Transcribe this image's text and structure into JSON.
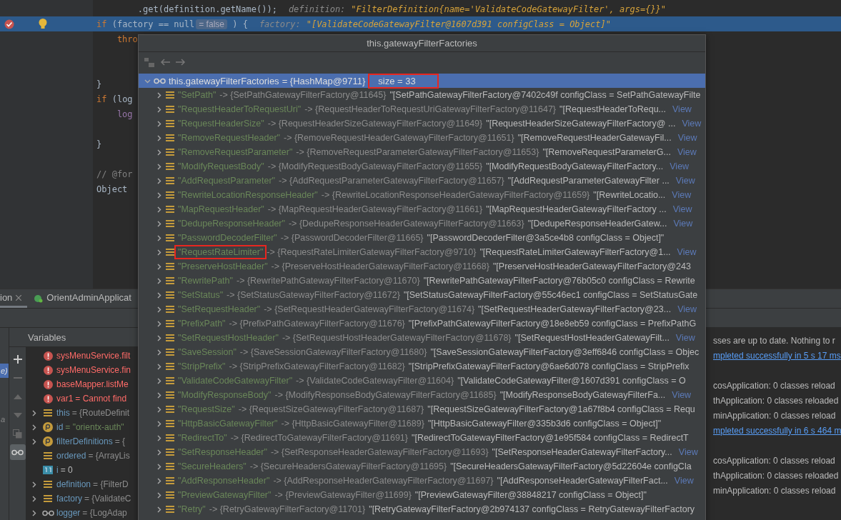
{
  "editor": {
    "lines": [
      {
        "breakpoint": false,
        "current": false,
        "segments": [
          {
            "kind": "code",
            "text": "        .get(definition.getName());"
          },
          {
            "kind": "hint_name",
            "text": "definition:"
          },
          {
            "kind": "hint_value",
            "text": "\"FilterDefinition{name='ValidateCodeGatewayFilter', args={}}\""
          }
        ]
      },
      {
        "breakpoint": true,
        "current": true,
        "segments": [
          {
            "kind": "keyword",
            "text": "if"
          },
          {
            "kind": "code",
            "text": " (factory == null"
          },
          {
            "kind": "badge",
            "text": "= false"
          },
          {
            "kind": "code",
            "text": " ) {"
          },
          {
            "kind": "hint_name",
            "text": "factory:"
          },
          {
            "kind": "hint_value",
            "text": "\"[ValidateCodeGatewayFilter@1607d391 configClass = Object]\""
          }
        ]
      },
      {
        "breakpoint": false,
        "current": false,
        "segments": [
          {
            "kind": "keyword",
            "text": "    thro"
          }
        ]
      },
      {
        "breakpoint": false,
        "current": false
      },
      {
        "breakpoint": false,
        "current": false
      },
      {
        "breakpoint": false,
        "current": false,
        "segments": [
          {
            "kind": "code",
            "text": "}"
          }
        ]
      },
      {
        "breakpoint": false,
        "current": false,
        "segments": [
          {
            "kind": "keyword",
            "text": "if"
          },
          {
            "kind": "code",
            "text": " (log"
          }
        ]
      },
      {
        "breakpoint": false,
        "current": false,
        "segments": [
          {
            "kind": "field",
            "text": "    log"
          }
        ]
      },
      {
        "breakpoint": false,
        "current": false
      },
      {
        "breakpoint": false,
        "current": false,
        "segments": [
          {
            "kind": "code",
            "text": "}"
          }
        ]
      },
      {
        "breakpoint": false,
        "current": false
      },
      {
        "breakpoint": false,
        "current": false,
        "segments": [
          {
            "kind": "comment",
            "text": "// @for"
          }
        ]
      },
      {
        "breakpoint": false,
        "current": false,
        "segments": [
          {
            "kind": "code",
            "text": "Object"
          }
        ]
      }
    ]
  },
  "debug": {
    "tabs": [
      {
        "label": "ion",
        "selected": true,
        "closable": true
      },
      {
        "label": "OrientAdminApplicat",
        "selected": false,
        "closable": false
      }
    ],
    "frames": [
      {
        "text": "e)",
        "selected": true
      },
      {
        "text": "a",
        "selected": false
      }
    ],
    "variables_title": "Variables",
    "tools": [
      {
        "kind": "add",
        "disabled": false,
        "selected": false
      },
      {
        "kind": "remove",
        "disabled": true,
        "selected": false
      },
      {
        "kind": "up",
        "disabled": true,
        "selected": false
      },
      {
        "kind": "down",
        "disabled": true,
        "selected": false
      },
      {
        "kind": "copy",
        "disabled": true,
        "selected": false
      },
      {
        "kind": "watches",
        "disabled": false,
        "selected": true
      }
    ],
    "variables": [
      {
        "kind": "error",
        "expandable": false,
        "name": "sysMenuService.filt"
      },
      {
        "kind": "error",
        "expandable": false,
        "name": "sysMenuService.fin"
      },
      {
        "kind": "error",
        "expandable": false,
        "name": "baseMapper.listMe"
      },
      {
        "kind": "error",
        "expandable": false,
        "name": "var1",
        "value": "= Cannot find"
      },
      {
        "kind": "object",
        "expandable": true,
        "name": "this",
        "value": "= {RouteDefinit"
      },
      {
        "kind": "field",
        "expandable": true,
        "name": "id",
        "value": "= \"orientx-auth\""
      },
      {
        "kind": "field",
        "expandable": true,
        "name": "filterDefinitions",
        "value": "= {"
      },
      {
        "kind": "object",
        "expandable": false,
        "name": "ordered",
        "value": "= {ArrayLis"
      },
      {
        "kind": "primitive",
        "expandable": false,
        "name": "i",
        "value": "= 0"
      },
      {
        "kind": "object",
        "expandable": true,
        "name": "definition",
        "value": "= {FilterD"
      },
      {
        "kind": "object",
        "expandable": true,
        "name": "factory",
        "value": "= {ValidateC"
      },
      {
        "kind": "watch",
        "expandable": true,
        "name": "logger",
        "value": "= {LogAdap"
      }
    ],
    "console": [
      {
        "kind": "text",
        "text": "sses are up to date. Nothing to r"
      },
      {
        "kind": "link",
        "text": "mpleted successfully in 5 s 17 ms"
      },
      {
        "kind": "text",
        "text": "cosApplication: 0 classes reload"
      },
      {
        "kind": "text",
        "text": "thApplication: 0 classes reloaded"
      },
      {
        "kind": "text",
        "text": "minApplication: 0 classes reload"
      },
      {
        "kind": "link",
        "text": "mpleted successfully in 6 s 464 m"
      },
      {
        "kind": "text",
        "text": "cosApplication: 0 classes reload"
      },
      {
        "kind": "text",
        "text": "thApplication: 0 classes reloaded"
      },
      {
        "kind": "text",
        "text": "minApplication: 0 classes reload"
      }
    ]
  },
  "popup": {
    "title": "this.gatewayFilterFactories",
    "root": {
      "name": "this.gatewayFilterFactories",
      "value": "= {HashMap@9711}",
      "size": "size = 33",
      "selected": true,
      "annotated": true
    },
    "entries": [
      {
        "key": "\"SetPath\"",
        "type": "-> {SetPathGatewayFilterFactory@11645}",
        "value": "\"[SetPathGatewayFilterFactory@7402c49f configClass = SetPathGatewayFilte",
        "annotated": false
      },
      {
        "key": "\"RequestHeaderToRequestUri\"",
        "type": "-> {RequestHeaderToRequestUriGatewayFilterFactory@11647}",
        "value": "\"[RequestHeaderToRequ...",
        "link": "View",
        "annotated": false
      },
      {
        "key": "\"RequestHeaderSize\"",
        "type": "-> {RequestHeaderSizeGatewayFilterFactory@11649}",
        "value": "\"[RequestHeaderSizeGatewayFilterFactory@ ...",
        "link": "View",
        "annotated": false
      },
      {
        "key": "\"RemoveRequestHeader\"",
        "type": "-> {RemoveRequestHeaderGatewayFilterFactory@11651}",
        "value": "\"[RemoveRequestHeaderGatewayFil...",
        "link": "View",
        "annotated": false
      },
      {
        "key": "\"RemoveRequestParameter\"",
        "type": "-> {RemoveRequestParameterGatewayFilterFactory@11653}",
        "value": "\"[RemoveRequestParameterG...",
        "link": "View",
        "annotated": false
      },
      {
        "key": "\"ModifyRequestBody\"",
        "type": "-> {ModifyRequestBodyGatewayFilterFactory@11655}",
        "value": "\"[ModifyRequestBodyGatewayFilterFactory...",
        "link": "View",
        "annotated": false
      },
      {
        "key": "\"AddRequestParameter\"",
        "type": "-> {AddRequestParameterGatewayFilterFactory@11657}",
        "value": "\"[AddRequestParameterGatewayFilter ...",
        "link": "View",
        "annotated": false
      },
      {
        "key": "\"RewriteLocationResponseHeader\"",
        "type": "-> {RewriteLocationResponseHeaderGatewayFilterFactory@11659}",
        "value": "\"[RewriteLocatio...",
        "link": "View",
        "annotated": false
      },
      {
        "key": "\"MapRequestHeader\"",
        "type": "-> {MapRequestHeaderGatewayFilterFactory@11661}",
        "value": "\"[MapRequestHeaderGatewayFilterFactory ...",
        "link": "View",
        "annotated": false
      },
      {
        "key": "\"DedupeResponseHeader\"",
        "type": "-> {DedupeResponseHeaderGatewayFilterFactory@11663}",
        "value": "\"[DedupeResponseHeaderGatew...",
        "link": "View",
        "annotated": false
      },
      {
        "key": "\"PasswordDecoderFilter\"",
        "type": "-> {PasswordDecoderFilter@11665}",
        "value": "\"[PasswordDecoderFilter@3a5ce4b8 configClass = Object]\"",
        "annotated": false
      },
      {
        "key": "\"RequestRateLimiter\"",
        "type": "-> {RequestRateLimiterGatewayFilterFactory@9710}",
        "value": "\"[RequestRateLimiterGatewayFilterFactory@1...",
        "link": "View",
        "annotated": true
      },
      {
        "key": "\"PreserveHostHeader\"",
        "type": "-> {PreserveHostHeaderGatewayFilterFactory@11668}",
        "value": "\"[PreserveHostHeaderGatewayFilterFactory@243",
        "annotated": false
      },
      {
        "key": "\"RewritePath\"",
        "type": "-> {RewritePathGatewayFilterFactory@11670}",
        "value": "\"[RewritePathGatewayFilterFactory@76b05c0 configClass = Rewrite",
        "annotated": false
      },
      {
        "key": "\"SetStatus\"",
        "type": "-> {SetStatusGatewayFilterFactory@11672}",
        "value": "\"[SetStatusGatewayFilterFactory@55c46ec1 configClass = SetStatusGate",
        "annotated": false
      },
      {
        "key": "\"SetRequestHeader\"",
        "type": "-> {SetRequestHeaderGatewayFilterFactory@11674}",
        "value": "\"[SetRequestHeaderGatewayFilterFactory@23...",
        "link": "View",
        "annotated": false
      },
      {
        "key": "\"PrefixPath\"",
        "type": "-> {PrefixPathGatewayFilterFactory@11676}",
        "value": "\"[PrefixPathGatewayFilterFactory@18e8eb59 configClass = PrefixPathG",
        "annotated": false
      },
      {
        "key": "\"SetRequestHostHeader\"",
        "type": "-> {SetRequestHostHeaderGatewayFilterFactory@11678}",
        "value": "\"[SetRequestHostHeaderGatewayFilt...",
        "link": "View",
        "annotated": false
      },
      {
        "key": "\"SaveSession\"",
        "type": "-> {SaveSessionGatewayFilterFactory@11680}",
        "value": "\"[SaveSessionGatewayFilterFactory@3eff6846 configClass = Objec",
        "annotated": false
      },
      {
        "key": "\"StripPrefix\"",
        "type": "-> {StripPrefixGatewayFilterFactory@11682}",
        "value": "\"[StripPrefixGatewayFilterFactory@6ae6d078 configClass = StripPrefix",
        "annotated": false
      },
      {
        "key": "\"ValidateCodeGatewayFilter\"",
        "type": "-> {ValidateCodeGatewayFilter@11604}",
        "value": "\"[ValidateCodeGatewayFilter@1607d391 configClass = O",
        "annotated": false
      },
      {
        "key": "\"ModifyResponseBody\"",
        "type": "-> {ModifyResponseBodyGatewayFilterFactory@11685}",
        "value": "\"[ModifyResponseBodyGatewayFilterFa...",
        "link": "View",
        "annotated": false
      },
      {
        "key": "\"RequestSize\"",
        "type": "-> {RequestSizeGatewayFilterFactory@11687}",
        "value": "\"[RequestSizeGatewayFilterFactory@1a67f8b4 configClass = Requ",
        "annotated": false
      },
      {
        "key": "\"HttpBasicGatewayFilter\"",
        "type": "-> {HttpBasicGatewayFilter@11689}",
        "value": "\"[HttpBasicGatewayFilter@335b3d6 configClass = Object]\"",
        "annotated": false
      },
      {
        "key": "\"RedirectTo\"",
        "type": "-> {RedirectToGatewayFilterFactory@11691}",
        "value": "\"[RedirectToGatewayFilterFactory@1e95f584 configClass = RedirectT",
        "annotated": false
      },
      {
        "key": "\"SetResponseHeader\"",
        "type": "-> {SetResponseHeaderGatewayFilterFactory@11693}",
        "value": "\"[SetResponseHeaderGatewayFilterFactory...",
        "link": "View",
        "annotated": false
      },
      {
        "key": "\"SecureHeaders\"",
        "type": "-> {SecureHeadersGatewayFilterFactory@11695}",
        "value": "\"[SecureHeadersGatewayFilterFactory@5d22604e configCla",
        "annotated": false
      },
      {
        "key": "\"AddResponseHeader\"",
        "type": "-> {AddResponseHeaderGatewayFilterFactory@11697}",
        "value": "\"[AddResponseHeaderGatewayFilterFact...",
        "link": "View",
        "annotated": false
      },
      {
        "key": "\"PreviewGatewayFilter\"",
        "type": "-> {PreviewGatewayFilter@11699}",
        "value": "\"[PreviewGatewayFilter@38848217 configClass = Object]\"",
        "annotated": false
      },
      {
        "key": "\"Retry\"",
        "type": "-> {RetryGatewayFilterFactory@11701}",
        "value": "\"[RetryGatewayFilterFactory@2b974137 configClass = RetryGatewayFilterFactory",
        "annotated": false
      }
    ]
  }
}
